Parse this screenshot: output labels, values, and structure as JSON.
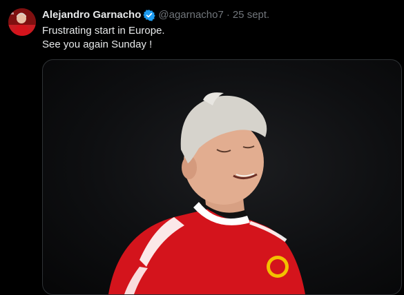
{
  "tweet": {
    "author_name": "Alejandro Garnacho",
    "handle": "@agarnacho7",
    "separator": "·",
    "date": "25 sept.",
    "text_lines": [
      "Frustrating start in Europe.",
      "See you again Sunday !"
    ]
  },
  "icons": {
    "verified": "verified-badge-icon",
    "avatar": "avatar"
  },
  "colors": {
    "background": "#000000",
    "text_primary": "#e7e9ea",
    "text_secondary": "#71767b",
    "verified_blue": "#1d9bf0",
    "jersey_red": "#d4141c"
  }
}
